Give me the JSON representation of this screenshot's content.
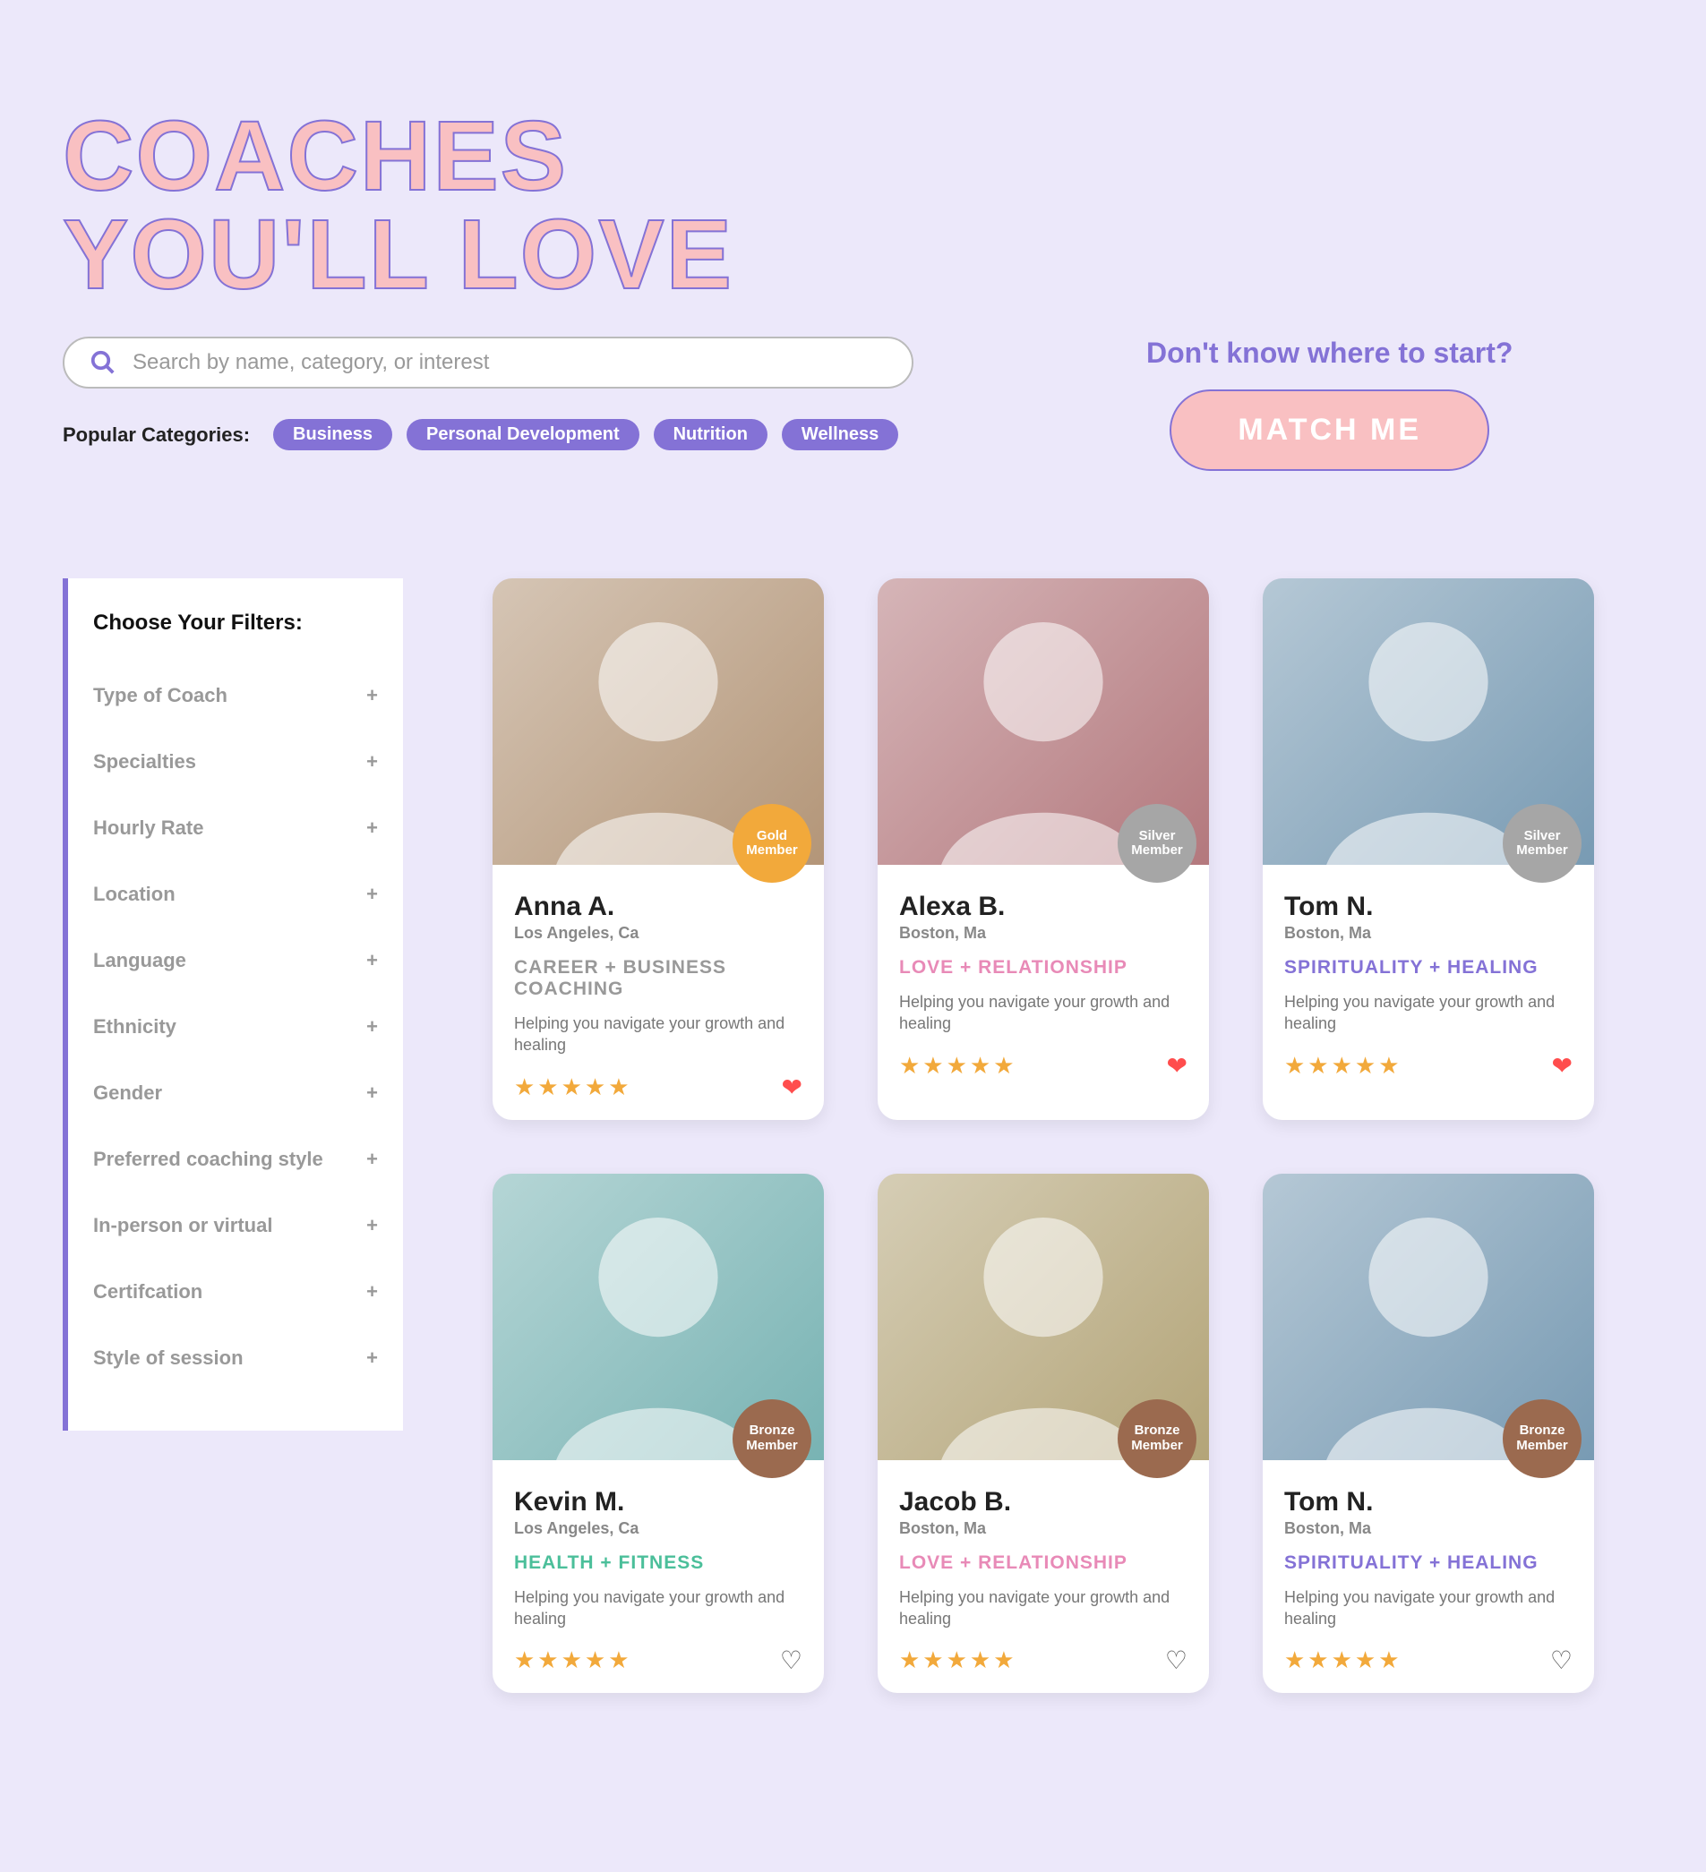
{
  "title_line1": "COACHES",
  "title_line2": "YOU'LL LOVE",
  "search": {
    "placeholder": "Search by name, category, or interest"
  },
  "popular": {
    "label": "Popular Categories:",
    "chips": [
      "Business",
      "Personal Development",
      "Nutrition",
      "Wellness"
    ]
  },
  "cta": {
    "heading": "Don't know where to start?",
    "button": "MATCH ME"
  },
  "filters": {
    "title": "Choose Your Filters:",
    "items": [
      "Type of Coach",
      "Specialties",
      "Hourly Rate",
      "Location",
      "Language",
      "Ethnicity",
      "Gender",
      "Preferred coaching style",
      "In-person or virtual",
      "Certifcation",
      "Style of session"
    ]
  },
  "member_tiers": {
    "gold": {
      "line1": "Gold",
      "line2": "Member"
    },
    "silver": {
      "line1": "Silver",
      "line2": "Member"
    },
    "bronze": {
      "line1": "Bronze",
      "line2": "Member"
    }
  },
  "coaches": [
    {
      "name": "Anna A.",
      "location": "Los Angeles, Ca",
      "category": "CAREER + BUSINESS COACHING",
      "category_class": "cat-career",
      "tagline": "Helping you navigate your growth and healing",
      "rating": 5,
      "tier": "gold",
      "favorited": true
    },
    {
      "name": "Alexa B.",
      "location": "Boston, Ma",
      "category": "LOVE + RELATIONSHIP",
      "category_class": "cat-love",
      "tagline": "Helping you navigate your growth and healing",
      "rating": 5,
      "tier": "silver",
      "favorited": true
    },
    {
      "name": "Tom N.",
      "location": "Boston, Ma",
      "category": "SPIRITUALITY + HEALING",
      "category_class": "cat-spirit",
      "tagline": "Helping you navigate your growth and healing",
      "rating": 5,
      "tier": "silver",
      "favorited": true
    },
    {
      "name": "Kevin M.",
      "location": "Los Angeles, Ca",
      "category": "HEALTH + FITNESS",
      "category_class": "cat-health",
      "tagline": "Helping you navigate your growth and healing",
      "rating": 5,
      "tier": "bronze",
      "favorited": false
    },
    {
      "name": "Jacob B.",
      "location": "Boston, Ma",
      "category": "LOVE + RELATIONSHIP",
      "category_class": "cat-love",
      "tagline": "Helping you navigate your growth and healing",
      "rating": 5,
      "tier": "bronze",
      "favorited": false
    },
    {
      "name": "Tom N.",
      "location": "Boston, Ma",
      "category": "SPIRITUALITY + HEALING",
      "category_class": "cat-spirit",
      "tagline": "Helping you navigate your growth and healing",
      "rating": 5,
      "tier": "bronze",
      "favorited": false
    }
  ]
}
